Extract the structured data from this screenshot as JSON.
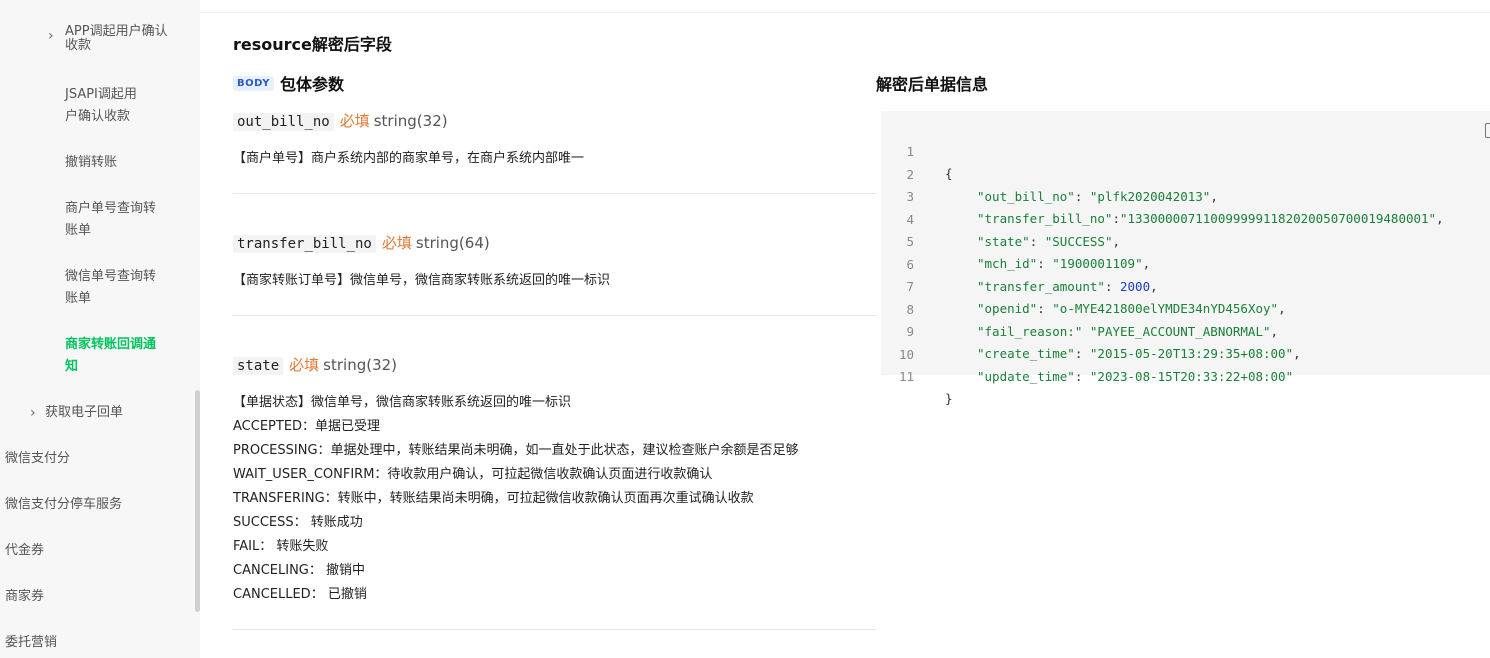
{
  "sidebar": {
    "items": [
      {
        "label": "APP调起用户确认收款",
        "expandable": true
      },
      {
        "label": "JSAPI调起用户确认收款"
      },
      {
        "label": "撤销转账"
      },
      {
        "label": "商户单号查询转账单"
      },
      {
        "label": "微信单号查询转账单"
      },
      {
        "label": "商家转账回调通知",
        "active": true
      },
      {
        "label": "获取电子回单",
        "expandable": true
      },
      {
        "label": "微信支付分"
      },
      {
        "label": "微信支付分停车服务"
      },
      {
        "label": "代金券"
      },
      {
        "label": "商家券"
      },
      {
        "label": "委托营销"
      }
    ]
  },
  "main": {
    "section_title": "resource解密后字段",
    "body_tag": "BODY",
    "body_title": "包体参数",
    "fields": [
      {
        "name": "out_bill_no",
        "required": "必填",
        "type": "string(32)",
        "desc": "【商户单号】商户系统内部的商家单号，在商户系统内部唯一"
      },
      {
        "name": "transfer_bill_no",
        "required": "必填",
        "type": "string(64)",
        "desc": "【商家转账订单号】微信单号，微信商家转账系统返回的唯一标识"
      },
      {
        "name": "state",
        "required": "必填",
        "type": "string(32)",
        "desc": "【单据状态】微信单号，微信商家转账系统返回的唯一标识",
        "lines": [
          "ACCEPTED：单据已受理",
          "PROCESSING：单据处理中，转账结果尚未明确，如一直处于此状态，建议检查账户余额是否足够",
          "WAIT_USER_CONFIRM：待收款用户确认，可拉起微信收款确认页面进行收款确认",
          "TRANSFERING：转账中，转账结果尚未明确，可拉起微信收款确认页面再次重试确认收款",
          "SUCCESS： 转账成功",
          "FAIL： 转账失败",
          "CANCELING： 撤销中",
          "CANCELLED： 已撤销"
        ]
      }
    ]
  },
  "right": {
    "title": "解密后单据信息",
    "code_lines": [
      {
        "no": "1",
        "text": "{"
      },
      {
        "no": "2",
        "key": "\"out_bill_no\"",
        "sep": ": ",
        "val": "\"plfk2020042013\"",
        "tail": ","
      },
      {
        "no": "3",
        "key": "\"transfer_bill_no\"",
        "sep": ":",
        "val": "\"1330000071100999991182020050700019480001\"",
        "tail": ","
      },
      {
        "no": "4",
        "key": "\"state\"",
        "sep": ": ",
        "val": "\"SUCCESS\"",
        "tail": ","
      },
      {
        "no": "5",
        "key": "\"mch_id\"",
        "sep": ": ",
        "val": "\"1900001109\"",
        "tail": ","
      },
      {
        "no": "6",
        "key": "\"transfer_amount\"",
        "sep": ": ",
        "num": "2000",
        "tail": ","
      },
      {
        "no": "7",
        "key": "\"openid\"",
        "sep": ": ",
        "val": "\"o-MYE421800elYMDE34nYD456Xoy\"",
        "tail": ","
      },
      {
        "no": "8",
        "key": "\"fail_reason:\"",
        "sep": " ",
        "val": "\"PAYEE_ACCOUNT_ABNORMAL\"",
        "tail": ","
      },
      {
        "no": "9",
        "key": "\"create_time\"",
        "sep": ": ",
        "val": "\"2015-05-20T13:29:35+08:00\"",
        "tail": ","
      },
      {
        "no": "10",
        "key": "\"update_time\"",
        "sep": ": ",
        "val": "\"2023-08-15T20:33:22+08:00\"",
        "tail": ""
      },
      {
        "no": "11",
        "text": "}"
      }
    ]
  },
  "colors": {
    "accent": "#07c160",
    "required": "#e07a35",
    "code_bg": "#f5f5f5"
  }
}
